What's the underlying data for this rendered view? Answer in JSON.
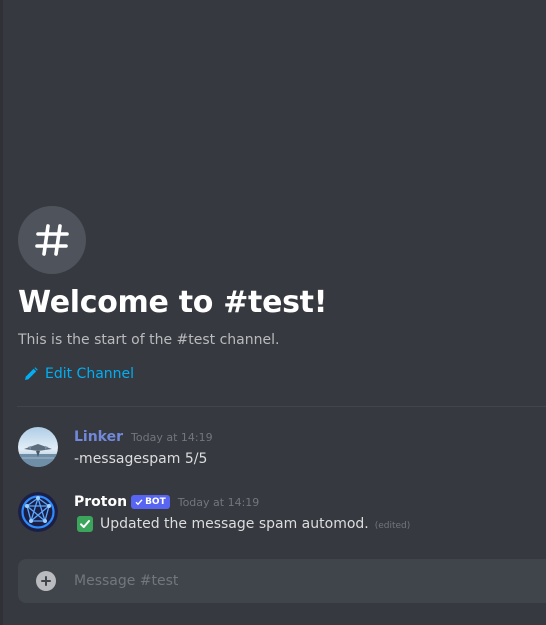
{
  "welcome": {
    "title": "Welcome to #test!",
    "subtitle": "This is the start of the #test channel.",
    "icon": "hashtag-icon"
  },
  "edit_channel": {
    "label": "Edit Channel",
    "icon": "pencil-icon"
  },
  "messages": [
    {
      "author": "Linker",
      "author_color": "#7289da",
      "timestamp": "Today at 14:19",
      "avatar": "jet-photo-avatar",
      "content": "-messagespam 5/5"
    },
    {
      "author": "Proton",
      "author_color": "#ffffff",
      "badge": "BOT",
      "badge_color": "#5865f2",
      "timestamp": "Today at 14:19",
      "avatar": "proton-logo-avatar",
      "emoji": "white-check-mark-icon",
      "content": "Updated the message spam automod.",
      "edited_label": "(edited)"
    }
  ],
  "composer": {
    "placeholder": "Message #test",
    "attach_icon": "plus-circle-icon"
  },
  "colors": {
    "background": "#36393f",
    "link": "#00aff4",
    "bot_badge": "#5865f2",
    "check_green": "#3ba55c"
  }
}
